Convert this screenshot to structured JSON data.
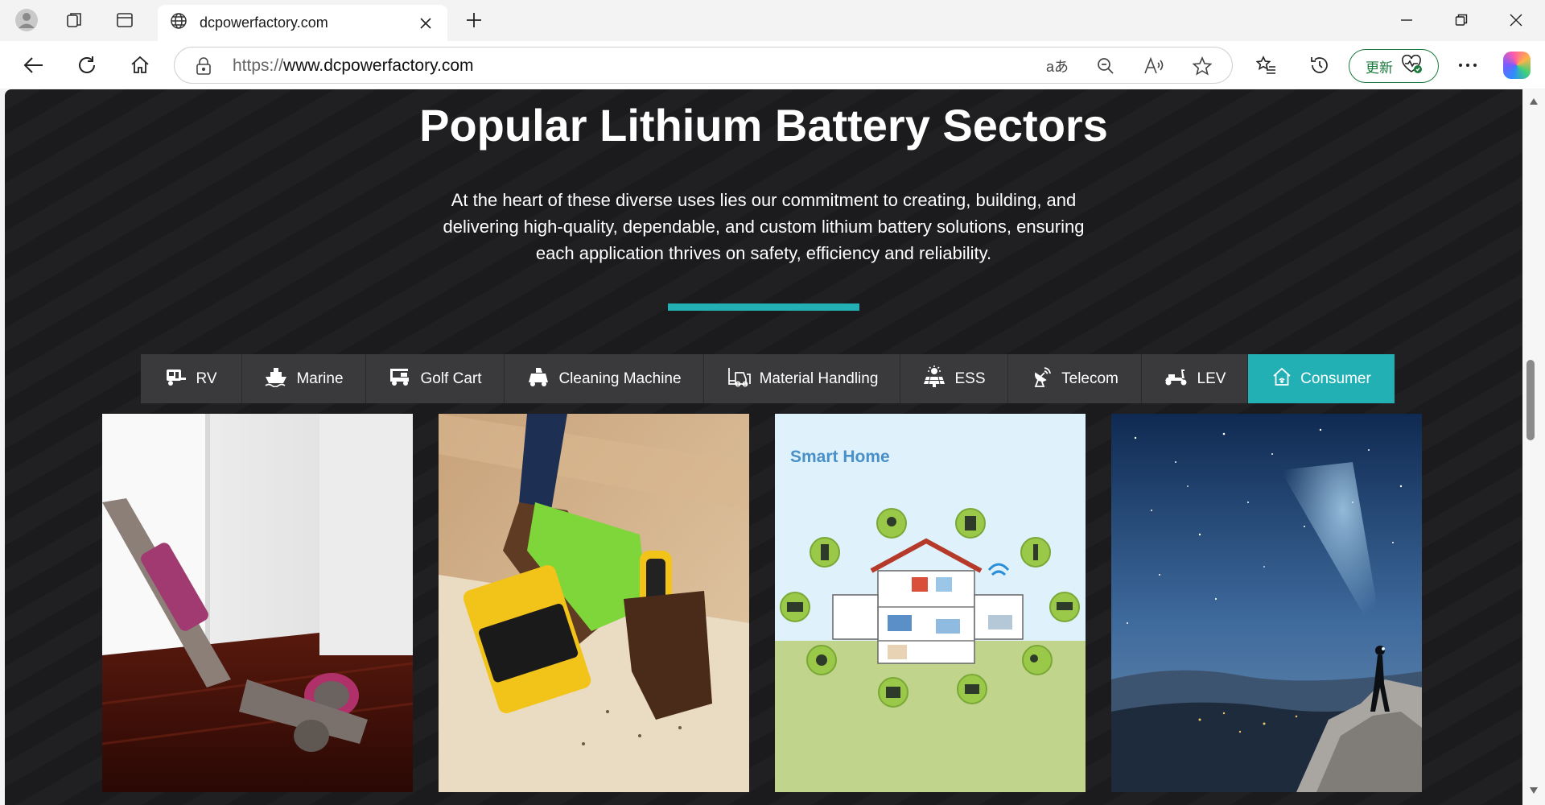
{
  "browser": {
    "tab_title": "dcpowerfactory.com",
    "url_scheme": "https://",
    "url_host": "www.dcpowerfactory.com",
    "update_label": "更新",
    "aria_translate": "aあ"
  },
  "page": {
    "heading": "Popular Lithium Battery Sectors",
    "lead": "At the heart of these diverse uses lies our commitment to creating, building, and delivering high-quality, dependable, and custom lithium battery solutions, ensuring each application thrives on safety, efficiency and reliability.",
    "accent_color": "#22b0b5",
    "tabs": [
      {
        "label": "RV",
        "icon": "rv-icon"
      },
      {
        "label": "Marine",
        "icon": "ship-icon"
      },
      {
        "label": "Golf Cart",
        "icon": "golf-cart-icon"
      },
      {
        "label": "Cleaning Machine",
        "icon": "cleaning-machine-icon"
      },
      {
        "label": "Material Handling",
        "icon": "forklift-icon"
      },
      {
        "label": "ESS",
        "icon": "solar-icon"
      },
      {
        "label": "Telecom",
        "icon": "antenna-icon"
      },
      {
        "label": "LEV",
        "icon": "scooter-icon"
      },
      {
        "label": "Consumer",
        "icon": "home-icon"
      }
    ],
    "active_tab": "Consumer",
    "gallery": [
      {
        "name": "vacuum-cleaner-image"
      },
      {
        "name": "power-drill-image"
      },
      {
        "name": "smart-home-image",
        "caption": "Smart Home"
      },
      {
        "name": "night-sky-headlamp-image"
      }
    ]
  }
}
